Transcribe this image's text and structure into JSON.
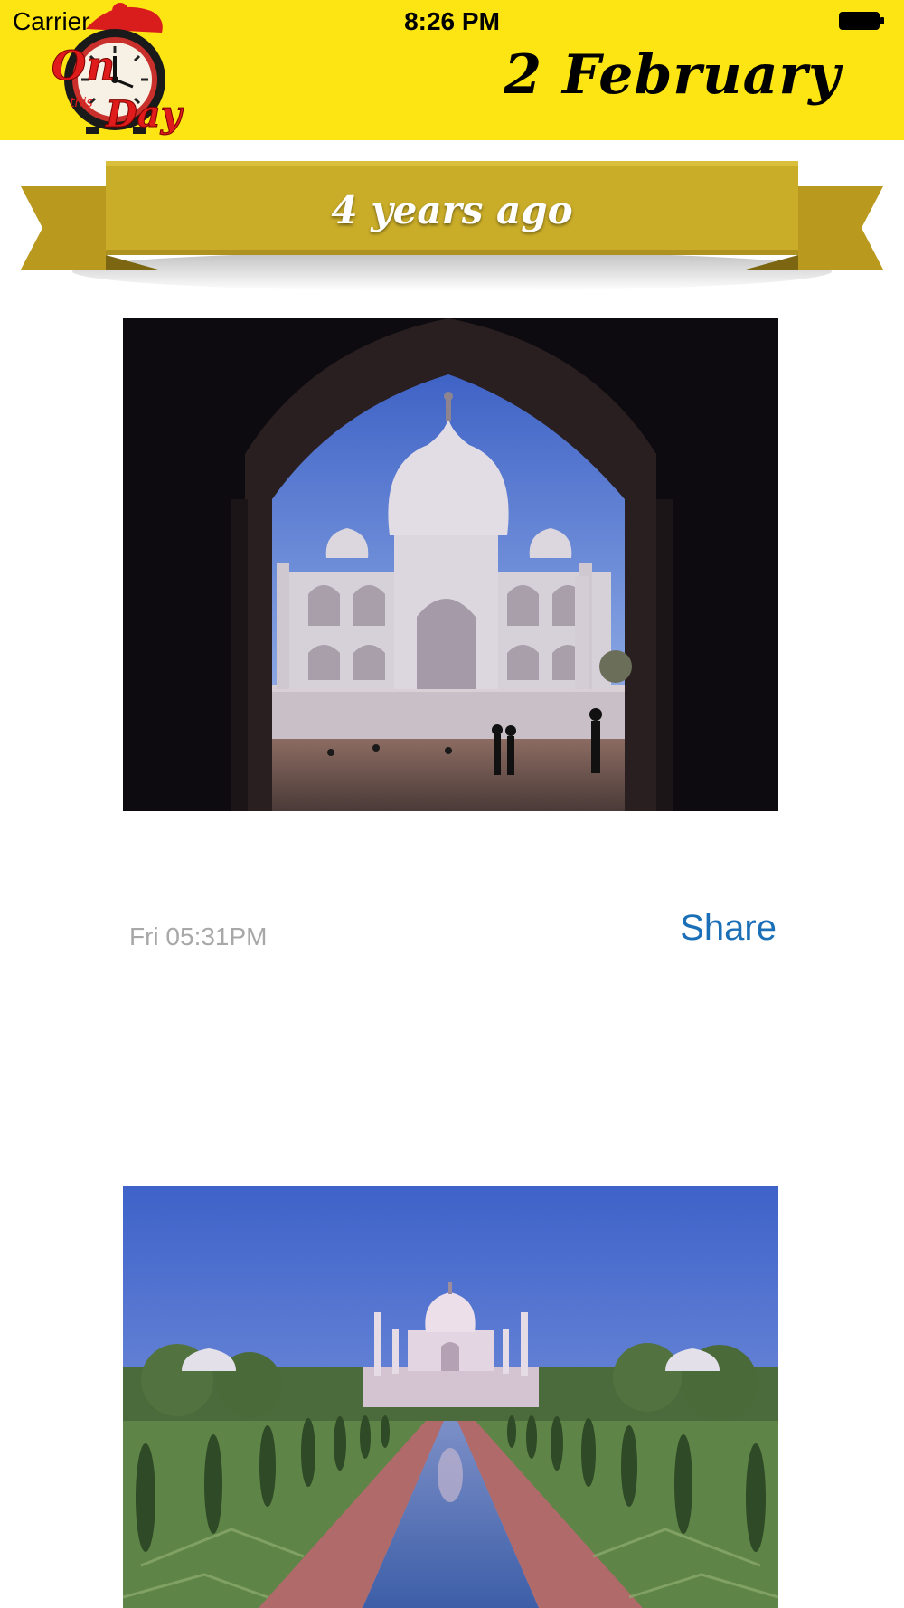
{
  "status_bar": {
    "carrier": "Carrier",
    "time": "8:26 PM"
  },
  "header": {
    "logo_icon": "on-this-day-clock-logo",
    "date": "2 February",
    "background_color": "#fde514"
  },
  "ribbon": {
    "label": "4 years ago",
    "color": "#c9ac28"
  },
  "post": {
    "photo_icon": "taj-mahal-through-arch-photo",
    "timestamp": "Fri 05:31PM",
    "share_label": "Share",
    "share_color": "#1a6fb7"
  },
  "next_post": {
    "photo_icon": "taj-mahal-garden-view-photo"
  }
}
